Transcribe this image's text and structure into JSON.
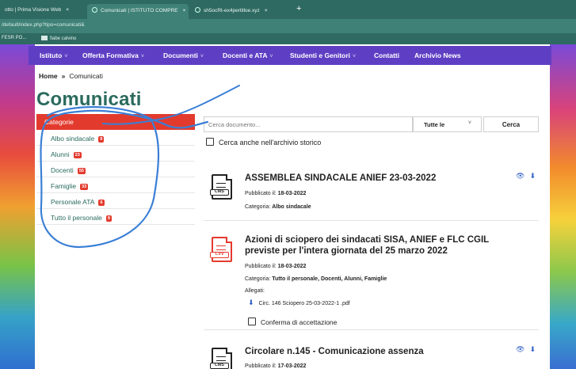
{
  "browser": {
    "tabs": [
      {
        "label": "otto | Prima Visione Web",
        "active": false
      },
      {
        "label": "Comunicati | ISTITUTO COMPRE",
        "active": true
      },
      {
        "label": "sh5ocRt-ex4pertilloe.xyz",
        "active": false
      }
    ],
    "tab_close": "×",
    "new_tab": "+",
    "url": "/default/index.php?tipo=comunicati&",
    "bookmarks": [
      "FESR PO...",
      "fiabe calvino"
    ]
  },
  "nav": {
    "items": [
      {
        "label": "Istituto",
        "dropdown": true
      },
      {
        "label": "Offerta Formativa",
        "dropdown": true
      },
      {
        "label": "Documenti",
        "dropdown": true
      },
      {
        "label": "Docenti e ATA",
        "dropdown": true
      },
      {
        "label": "Studenti e Genitori",
        "dropdown": true
      },
      {
        "label": "Contatti",
        "dropdown": false
      },
      {
        "label": "Archivio News",
        "dropdown": false
      }
    ],
    "caret": "˅"
  },
  "breadcrumb": {
    "home": "Home",
    "sep": "»",
    "current": "Comunicati"
  },
  "page_title": "Comunicati",
  "categories": {
    "header": "Categorie",
    "items": [
      {
        "label": "Albo sindacale",
        "count": "9"
      },
      {
        "label": "Alunni",
        "count": "23"
      },
      {
        "label": "Docenti",
        "count": "55"
      },
      {
        "label": "Famiglie",
        "count": "33"
      },
      {
        "label": "Personale ATA",
        "count": "6"
      },
      {
        "label": "Tutto il personale",
        "count": "9"
      }
    ]
  },
  "search": {
    "placeholder": "Cerca documento...",
    "filter": "Tutte le",
    "button": "Cerca",
    "archive_label": "Cerca anche nell'archivio storico"
  },
  "posts": [
    {
      "title": "ASSEMBLEA SINDACALE ANIEF 23-03-2022",
      "icon_tag": "CMS",
      "published_label": "Pubblicato il: ",
      "published": "18-03-2022",
      "category_label": "Categoria: ",
      "category": "Albo sindacale",
      "actions": [
        "👁",
        "⬇"
      ]
    },
    {
      "title_line1": "Azioni di sciopero dei sindacati SISA, ANIEF e FLC CGIL",
      "title_line2": "previste per l'intera giornata del 25 marzo 2022",
      "icon_tag": "CVV",
      "published_label": "Pubblicato il: ",
      "published": "18-03-2022",
      "category_label": "Categoria: ",
      "category": "Tutto il personale, Docenti, Alunni, Famiglie",
      "attachments_label": "Allegati:",
      "attachment": "Circ. 146 Sciopero 25-03-2022-1 .pdf",
      "confirm_label": "Conferma di accettazione"
    },
    {
      "title": "Circolare n.145 - Comunicazione assenza",
      "icon_tag": "CMS",
      "published_label": "Pubblicato il: ",
      "published": "17-03-2022",
      "actions": [
        "👁",
        "⬇"
      ]
    }
  ],
  "colors": {
    "nav": "#5e3fc4",
    "category_header": "#e33a2e",
    "title": "#2a6b5e",
    "link_icons": "#2f5fc4",
    "scribble": "#3a7fd6"
  }
}
